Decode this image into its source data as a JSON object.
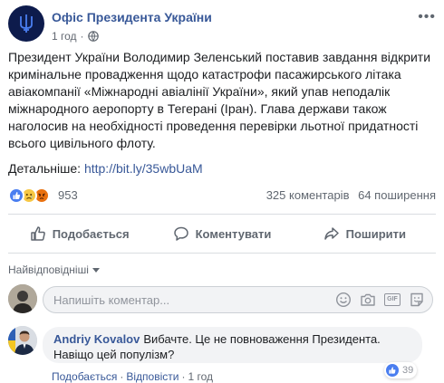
{
  "post": {
    "page_name": "Офіс Президента України",
    "time": "1 год",
    "dot": "·",
    "text": "Президент України Володимир Зеленський поставив завдання відкрити кримінальне провадження щодо катастрофи пасажирського літака авіакомпанії «Міжнародні авіалінії України», який упав неподалік міжнародного аеропорту в Тегерані (Іран). Глава держави також наголосив на необхідності проведення перевірки льотної придатності всього цивільного флоту.",
    "details_label": "Детальніше:",
    "link": "http://bit.ly/35wbUaM",
    "more_icon": "more-dots-icon"
  },
  "reactions": {
    "count": "953",
    "types": [
      "like",
      "sad",
      "angry"
    ],
    "comments": "325 коментарів",
    "shares": "64 поширення"
  },
  "actions": {
    "like": "Подобається",
    "comment": "Коментувати",
    "share": "Поширити"
  },
  "comments": {
    "sort_label": "Найвідповідніші",
    "input_placeholder": "Напишіть коментар...",
    "items": [
      {
        "author": "Andriy Kovalov",
        "text": "Вибачте. Це не повноваження Президента. Навіщо цей популізм?",
        "likes": "39",
        "like_label": "Подобається",
        "reply_label": "Відповісти",
        "time": "1 год",
        "sep": "·"
      }
    ]
  },
  "colors": {
    "link": "#385898",
    "like_blue": "#4a7ef0",
    "muted": "#606770"
  }
}
